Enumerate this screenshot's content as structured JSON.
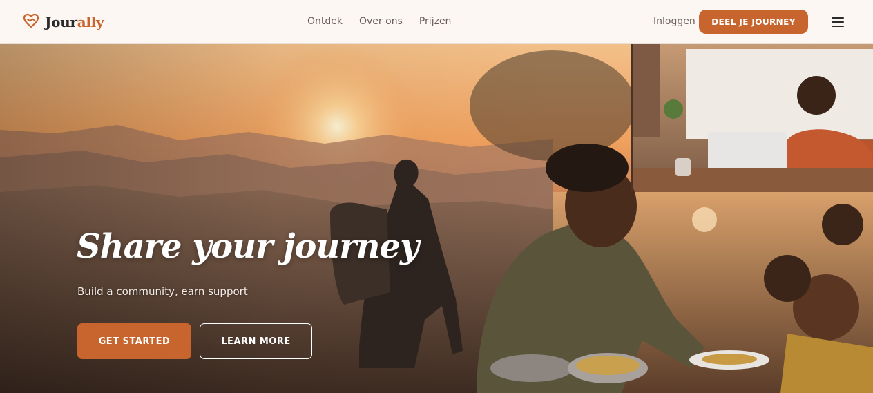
{
  "brand": {
    "name_prefix": "Jour",
    "name_suffix": "ally",
    "accent_color": "#c8652e",
    "logo_icon": "heart-handshake-icon"
  },
  "nav": {
    "items": [
      {
        "label": "Ontdek"
      },
      {
        "label": "Over ons"
      },
      {
        "label": "Prijzen"
      }
    ],
    "login_label": "Inloggen",
    "cta_label": "DEEL JE JOURNEY",
    "menu_icon": "hamburger-menu-icon"
  },
  "hero": {
    "title": "Share your journey",
    "subtitle": "Build a community, earn support",
    "primary_button": "GET STARTED",
    "secondary_button": "LEARN MORE",
    "image_left": "hiker-overlooking-sunset-valley",
    "image_top_right": "man-working-laptop-business-idea-whiteboard",
    "image_bottom_right": "volunteer-serving-food-to-children"
  }
}
